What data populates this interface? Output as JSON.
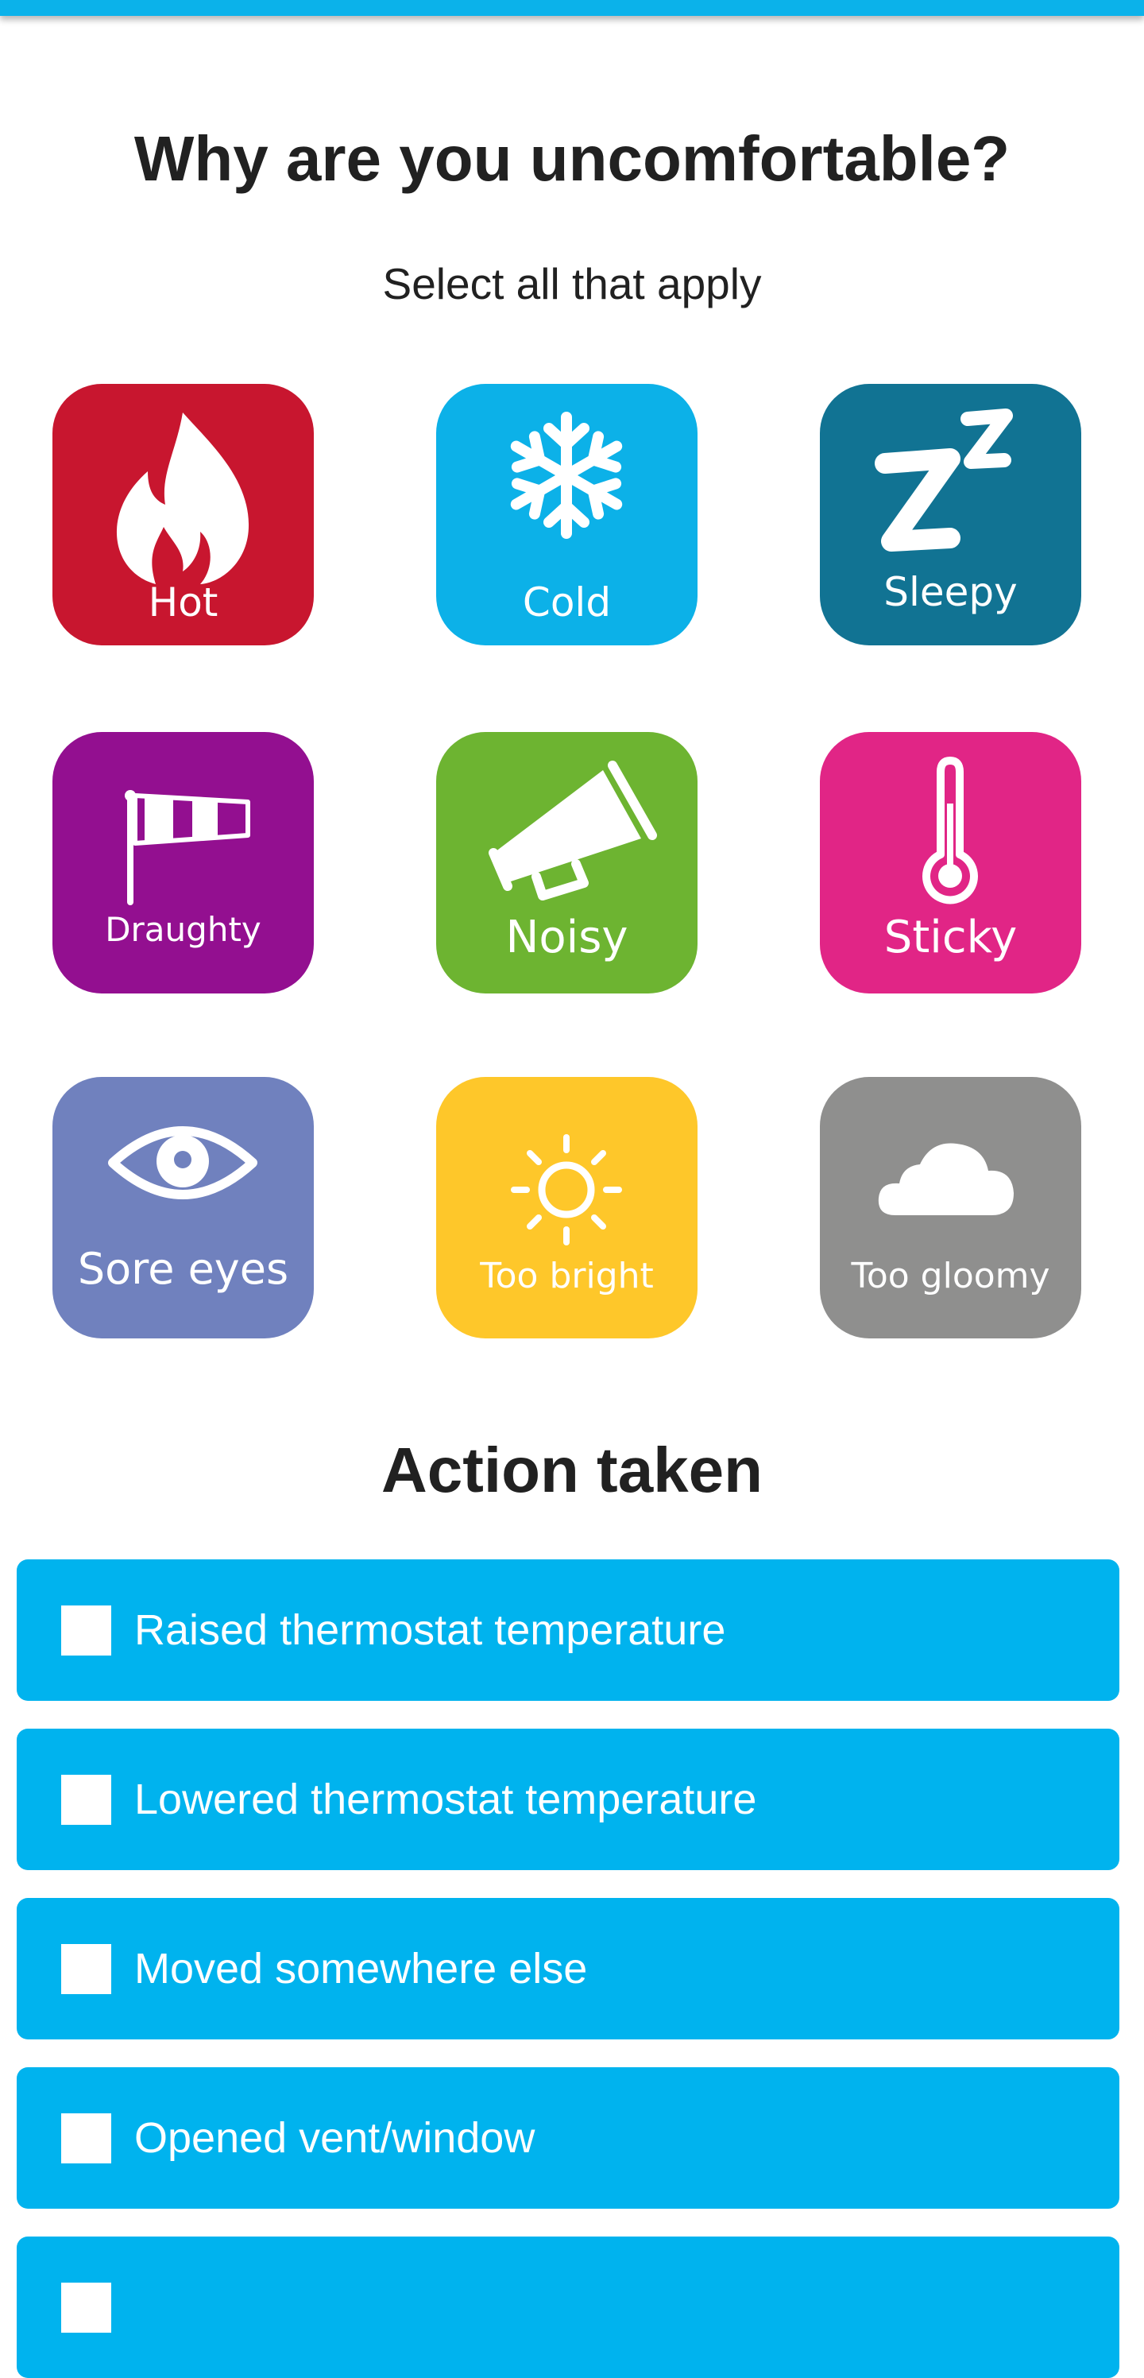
{
  "header": {
    "title": "Why are you uncomfortable?",
    "subtitle": "Select all that apply"
  },
  "reasons": [
    {
      "label": "Hot",
      "icon": "flame-icon",
      "color": "#c8162f"
    },
    {
      "label": "Cold",
      "icon": "snowflake-icon",
      "color": "#0cb1e8"
    },
    {
      "label": "Sleepy",
      "icon": "zz-icon",
      "color": "#117393"
    },
    {
      "label": "Draughty",
      "icon": "windsock-icon",
      "color": "#930f90"
    },
    {
      "label": "Noisy",
      "icon": "megaphone-icon",
      "color": "#6db431"
    },
    {
      "label": "Sticky",
      "icon": "thermometer-icon",
      "color": "#e12586"
    },
    {
      "label": "Sore eyes",
      "icon": "eye-icon",
      "color": "#7081be"
    },
    {
      "label": "Too bright",
      "icon": "sun-icon",
      "color": "#fec72a"
    },
    {
      "label": "Too gloomy",
      "icon": "cloud-icon",
      "color": "#8f8f8e"
    }
  ],
  "actions": {
    "title": "Action taken",
    "color": "#00b3ee",
    "items": [
      {
        "label": "Raised thermostat temperature",
        "checked": false
      },
      {
        "label": "Lowered thermostat temperature",
        "checked": false
      },
      {
        "label": "Moved somewhere else",
        "checked": false
      },
      {
        "label": "Opened vent/window",
        "checked": false
      }
    ]
  }
}
